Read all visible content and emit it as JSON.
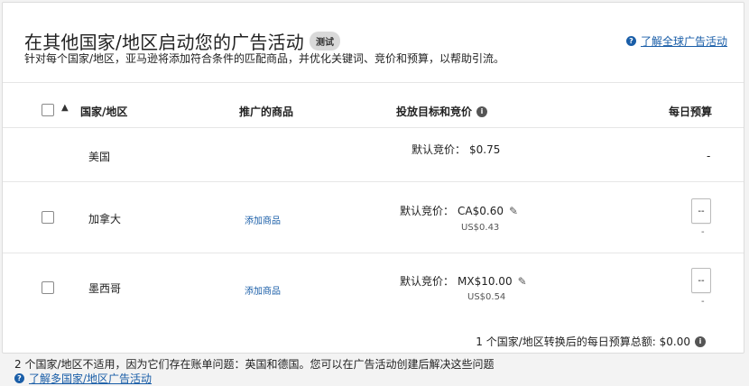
{
  "header": {
    "title": "在其他国家/地区启动您的广告活动",
    "badge": "测试",
    "subtitle": "针对每个国家/地区，亚马逊将添加符合条件的匹配商品，并优化关键词、竞价和预算，以帮助引流。",
    "learn_link": "了解全球广告活动"
  },
  "table": {
    "columns": {
      "country": "国家/地区",
      "products": "推广的商品",
      "targeting": "投放目标和竞价",
      "budget": "每日预算"
    },
    "rows": [
      {
        "country": "美国",
        "bid_label": "默认竞价：",
        "bid_value": "$0.75",
        "budget": "-"
      },
      {
        "country": "加拿大",
        "products_link": "添加商品",
        "bid_label": "默认竞价：",
        "bid_value": "CA$0.60",
        "usd": "US$0.43",
        "budget_input": "--",
        "budget_sub": "-"
      },
      {
        "country": "墨西哥",
        "products_link": "添加商品",
        "bid_label": "默认竞价：",
        "bid_value": "MX$10.00",
        "usd": "US$0.54",
        "budget_input": "--",
        "budget_sub": "-"
      }
    ]
  },
  "total": "1 个国家/地区转换后的每日预算总额: $0.00",
  "footer": {
    "note": "2 个国家/地区不适用，因为它们存在账单问题：英国和德国。您可以在广告活动创建后解决这些问题",
    "link": "了解多国家/地区广告活动"
  },
  "colors": {
    "link": "#1a5ea8",
    "badge_bg": "#d9d9d9",
    "divider": "#e6e6e6"
  }
}
